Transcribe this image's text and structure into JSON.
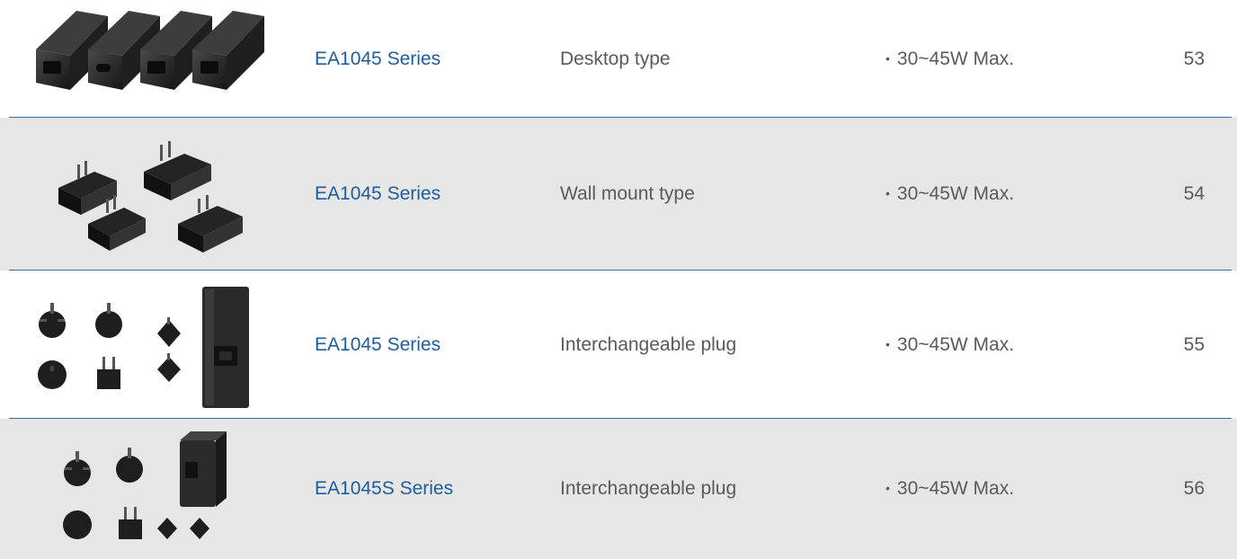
{
  "rows": [
    {
      "series": "EA1045 Series",
      "type": "Desktop type",
      "power": "30~45W Max.",
      "page": "53",
      "image_icon": "desktop-adapters-icon"
    },
    {
      "series": "EA1045 Series",
      "type": "Wall mount type",
      "power": "30~45W Max.",
      "page": "54",
      "image_icon": "wall-mount-adapters-icon"
    },
    {
      "series": "EA1045 Series",
      "type": "Interchangeable plug",
      "power": "30~45W Max.",
      "page": "55",
      "image_icon": "interchangeable-plugs-icon"
    },
    {
      "series": "EA1045S Series",
      "type": "Interchangeable plug",
      "power": "30~45W Max.",
      "page": "56",
      "image_icon": "interchangeable-plugs-compact-icon"
    }
  ],
  "bullet": "•",
  "colors": {
    "series_link": "#1d5d9c",
    "separator": "#2f6ea7",
    "shaded_row": "#e6e6e6",
    "text": "#5a5a5a"
  }
}
